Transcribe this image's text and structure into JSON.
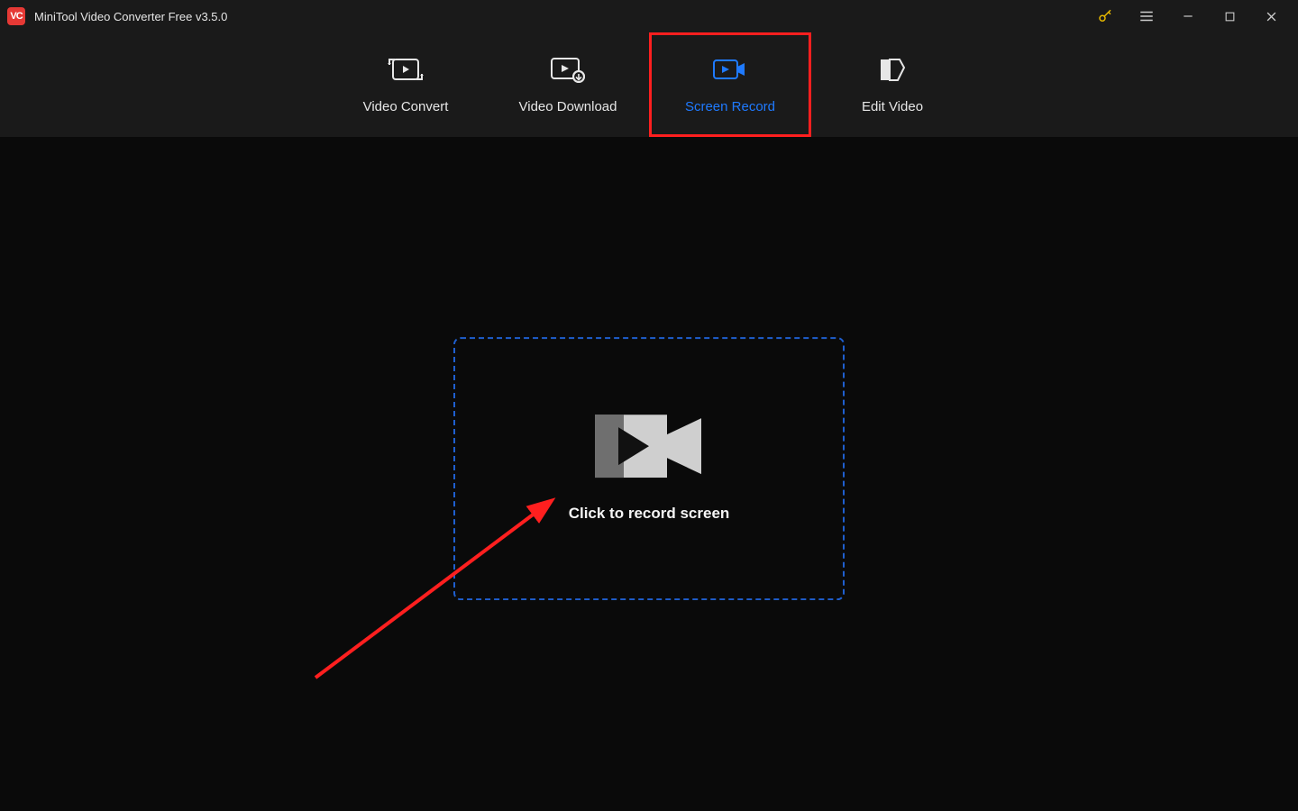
{
  "titlebar": {
    "app_logo_text": "VC",
    "title": "MiniTool Video Converter Free v3.5.0"
  },
  "tabs": [
    {
      "label": "Video Convert"
    },
    {
      "label": "Video Download"
    },
    {
      "label": "Screen Record"
    },
    {
      "label": "Edit Video"
    }
  ],
  "main": {
    "record_prompt": "Click to record screen"
  }
}
